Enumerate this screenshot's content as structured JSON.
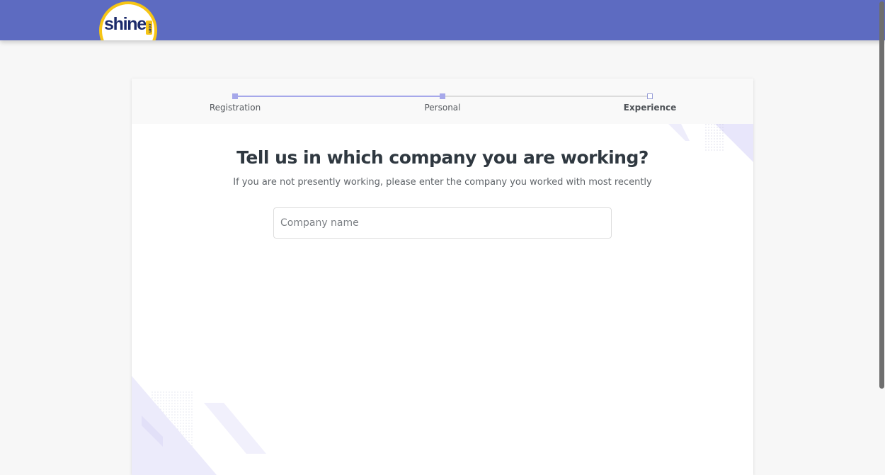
{
  "header": {
    "logo_text": "shine",
    "logo_suffix": ".com",
    "brand_color": "#5d6bc1",
    "logo_accent": "#f6c515"
  },
  "stepper": {
    "steps": [
      {
        "label": "Registration",
        "status": "done"
      },
      {
        "label": "Personal",
        "status": "done"
      },
      {
        "label": "Experience",
        "status": "current"
      }
    ],
    "done_color": "#a6a8ea"
  },
  "form": {
    "title": "Tell us in which company you are working?",
    "subtitle": "If you are not presently working, please enter the company you worked with most recently",
    "company_input": {
      "placeholder": "Company name",
      "value": ""
    }
  }
}
